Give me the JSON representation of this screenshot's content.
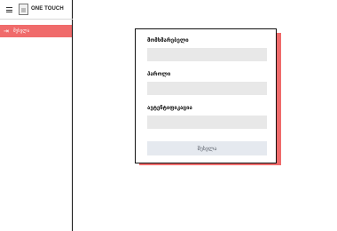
{
  "sidebar": {
    "brand": "ONE TOUCH",
    "menu_icon": "hamburger-icon",
    "logo_icon": "app-logo",
    "items": [
      {
        "label": "შესვლა",
        "icon": "login-arrow-icon",
        "active": true
      }
    ]
  },
  "login_form": {
    "username_label": "მომხმარებელი",
    "username_value": "",
    "password_label": "პაროლი",
    "password_value": "",
    "auth_label": "ავტენტიფიკაცია",
    "auth_value": "",
    "submit_label": "შესვლა"
  },
  "colors": {
    "accent": "#f06b6b",
    "card_shadow": "#ef6b6b",
    "input_bg": "#e8e8e8",
    "button_bg": "#e5e9ef"
  }
}
